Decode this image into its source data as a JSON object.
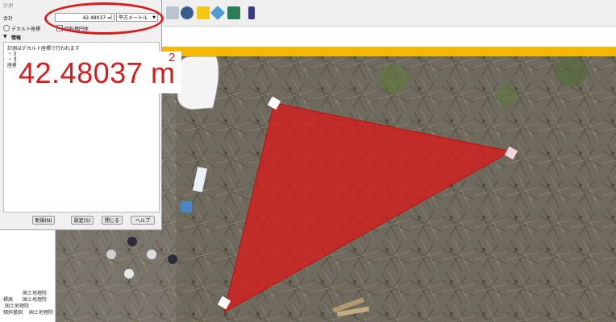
{
  "dialog": {
    "title": "計測",
    "total_label": "合計",
    "total_value": "42.48037 ㎡",
    "unit_selected": "平方メートル",
    "cartesian_label": "デカルト座標",
    "ellipsoidal_label": "回転楕円体",
    "info_header": "情報",
    "info_lines": [
      "計測はデカルト座標で行われます",
      "・ 測",
      "・ 単",
      "座標"
    ],
    "buttons": {
      "new": "新規(N)",
      "settings": "設定(S)",
      "close": "閉じる",
      "help": "ヘルプ"
    }
  },
  "overlay": {
    "area_value": "42.48037",
    "area_unit": "m",
    "area_exp": "2"
  },
  "layers": [
    "国土地理院",
    "標高",
    "国土地理院",
    "国土地理院",
    "傾斜量図",
    "国土地理院"
  ],
  "colors": {
    "accent_red": "#d81b1b",
    "header_bar": "#f5b800",
    "polygon_fill": "#d81b1b"
  }
}
